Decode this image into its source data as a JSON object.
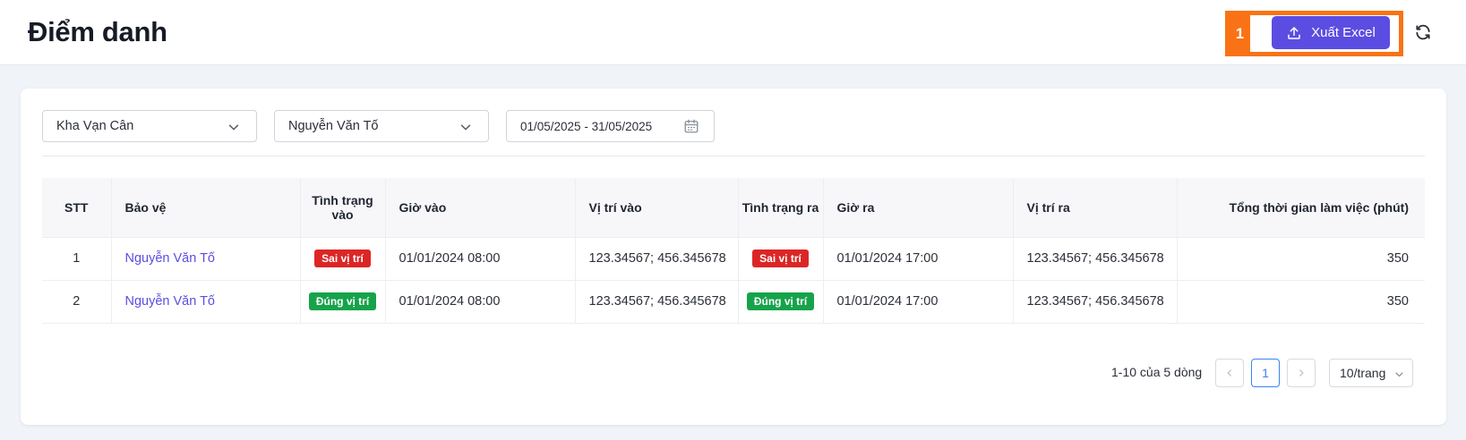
{
  "header": {
    "title": "Điểm danh",
    "highlight_label": "1",
    "export_label": "Xuất Excel"
  },
  "filters": {
    "location": "Kha Vạn Cân",
    "guard": "Nguyễn Văn Tố",
    "date_range": "01/05/2025 - 31/05/2025"
  },
  "table": {
    "columns": [
      "STT",
      "Bảo vệ",
      "Tình trạng vào",
      "Giờ vào",
      "Vị trí vào",
      "Tình trạng ra",
      "Giờ ra",
      "Vị trí ra",
      "Tổng thời gian làm việc (phút)"
    ],
    "rows": [
      {
        "stt": "1",
        "guard": "Nguyễn Văn Tố",
        "in_status": "Sai vị trí",
        "in_time": "01/01/2024 08:00",
        "in_pos": "123.34567; 456.345678",
        "out_status": "Sai vị trí",
        "out_time": "01/01/2024 17:00",
        "out_pos": "123.34567; 456.345678",
        "total": "350"
      },
      {
        "stt": "2",
        "guard": "Nguyễn Văn Tố",
        "in_status": "Đúng vị trí",
        "in_time": "01/01/2024 08:00",
        "in_pos": "123.34567; 456.345678",
        "out_status": "Đúng vị trí",
        "out_time": "01/01/2024 17:00",
        "out_pos": "123.34567; 456.345678",
        "total": "350"
      }
    ]
  },
  "pagination": {
    "info": "1-10 của 5 dòng",
    "current_page": "1",
    "page_size": "10/trang"
  },
  "colors": {
    "primary": "#5b4de2",
    "highlight": "#f97316",
    "status_wrong": "#dc2626",
    "status_correct": "#16a34a"
  },
  "icons": {
    "export": "upload-icon",
    "refresh": "refresh-icon",
    "dropdown": "chevron-down-icon",
    "calendar": "calendar-icon",
    "prev": "chevron-left-icon",
    "next": "chevron-right-icon"
  }
}
